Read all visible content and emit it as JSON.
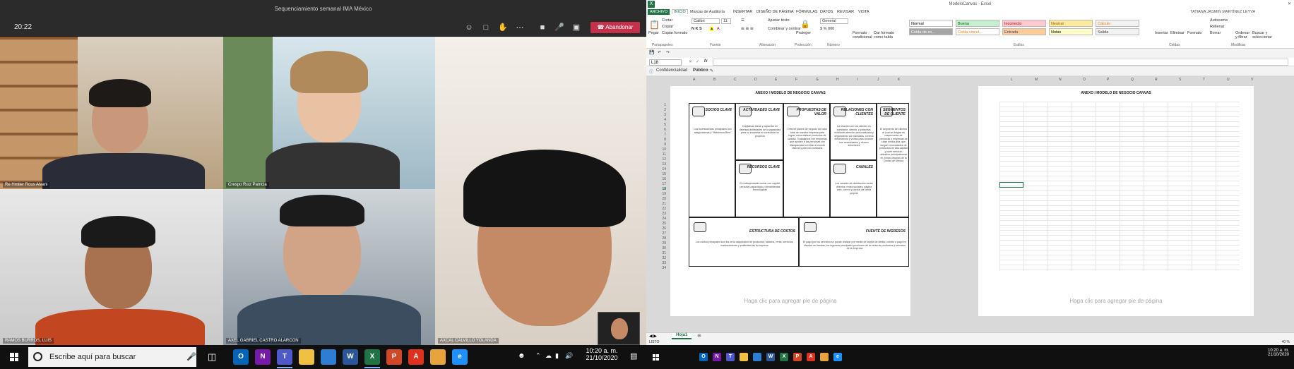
{
  "teams": {
    "window_title": "Sequenciamiento semanal IMA México",
    "time": "20:22",
    "leave_label": "Abandonar",
    "participants": [
      {
        "name": "Re Hmtier Rous Alvani"
      },
      {
        "name": "Crespo Ruiz Patricia"
      },
      {
        "name": "RAMOS BURROS, LUIS"
      },
      {
        "name": "AXEL GABRIEL CASTRO ALARCON"
      },
      {
        "name": "AXCAL CALVILLO YOLANDA"
      }
    ]
  },
  "excel": {
    "title": "ModeloCanvas - Excel",
    "user": "TATIANA JASMIN MARTÍNEZ LEYVA",
    "tabs": [
      "ARCHIVO",
      "INICIO",
      "Marcas de Auditoría",
      "INSERTAR",
      "DISEÑO DE PÁGINA",
      "FÓRMULAS",
      "DATOS",
      "REVISAR",
      "VISTA"
    ],
    "ribbon": {
      "paste": "Pegar",
      "cut": "Cortar",
      "copy": "Copiar",
      "format_painter": "Copiar formato",
      "font_name": "Calibri",
      "font_size": "11",
      "wrap_text": "Ajustar texto",
      "merge": "Combinar y centrar",
      "number_format": "General",
      "protect": "Proteger",
      "cond_format": "Formato condicional",
      "format_table": "Dar formato como tabla",
      "insert": "Insertar",
      "delete": "Eliminar",
      "format": "Formato",
      "autosum": "Autosuma",
      "fill": "Rellenar",
      "clear": "Borrar",
      "sort_filter": "Ordenar y filtrar",
      "find_select": "Buscar y seleccionar",
      "groups": [
        "Portapapeles",
        "Fuente",
        "Alineación",
        "Protección",
        "Número",
        "Estilos",
        "Celdas",
        "Modificar"
      ],
      "styles": [
        {
          "label": "Normal",
          "bg": "#ffffff",
          "fg": "#000000"
        },
        {
          "label": "Buena",
          "bg": "#c6efce",
          "fg": "#006100"
        },
        {
          "label": "Incorrecto",
          "bg": "#ffc7ce",
          "fg": "#9c0006"
        },
        {
          "label": "Neutral",
          "bg": "#ffeb9c",
          "fg": "#9c5700"
        },
        {
          "label": "Cálculo",
          "bg": "#f2f2f2",
          "fg": "#fa7d00"
        },
        {
          "label": "Celda de co...",
          "bg": "#a5a5a5",
          "fg": "#ffffff"
        },
        {
          "label": "Celda vincul...",
          "bg": "#ffffff",
          "fg": "#fa7d00"
        },
        {
          "label": "Entrada",
          "bg": "#ffcc99",
          "fg": "#3f3f76"
        },
        {
          "label": "Notas",
          "bg": "#ffffcc",
          "fg": "#000000"
        },
        {
          "label": "Salida",
          "bg": "#f2f2f2",
          "fg": "#3f3f3f"
        }
      ]
    },
    "name_box": "L18",
    "fx": "fx",
    "info_bar": {
      "label": "Confidencialidad",
      "value": "Público"
    },
    "columns_left": [
      "A",
      "B",
      "C",
      "D",
      "E",
      "F",
      "G",
      "H",
      "I",
      "J",
      "K"
    ],
    "columns_right": [
      "L",
      "M",
      "N",
      "O",
      "P",
      "Q",
      "R",
      "S",
      "T",
      "U",
      "V"
    ],
    "rows": [
      "1",
      "2",
      "3",
      "4",
      "5",
      "6",
      "7",
      "8",
      "9",
      "10",
      "11",
      "12",
      "13",
      "14",
      "15",
      "16",
      "17",
      "18",
      "19",
      "20",
      "21",
      "22",
      "23",
      "24",
      "25",
      "26",
      "27",
      "28",
      "29",
      "30",
      "31",
      "32",
      "33",
      "34"
    ],
    "page_title": "ANEXO I MODELO DE NEGOCIO CANVAS",
    "page2_title": "ANEXO I MODELO DE NEGOCIO CANVAS",
    "canvas": {
      "socios": {
        "title": "SOCIOS CLAVE",
        "text": "Los inversionistas principales son aseguradoras y \"Hablemos Bien\""
      },
      "actividades": {
        "title": "ACTIVIDADES CLAVE",
        "text": "Capitalizar ideas y capacitar en diversas actividades de la capacidad para su empresa en consolidar su proyecto"
      },
      "propuestas": {
        "title": "PROPUESTAS DE VALOR",
        "text": "Ofrecer planes de negocio de valor total de nuestra empresa para lograr comercializar productos de calidad. Trabajamos con empresas que ayuden a las personas con discapacidad a entrar al mundo laboral y para los invitados"
      },
      "relaciones": {
        "title": "RELACIONES CON CLIENTES",
        "text": "La relación con los clientes es constante, directa, y proactiva; mediante atención personalizada y seguimiento con llamadas, correos electrónicos y visitas para conocer sus necesidades y ofrecer soluciones"
      },
      "segmentos": {
        "title": "SEGMENTOS DE CLIENTE",
        "text": "El segmento de clientes al cual se dirigirá es mayormente de personas y empresas de clase media-alta, que tengan necesidades de productos de alta calidad y buen servicio; ubicados principalmente en zonas urbanas de la Ciudad de México"
      },
      "recursos": {
        "title": "RECURSOS CLAVE",
        "text": "Es indispensable contar con capital, personal capacitado y herramientas tecnológicas"
      },
      "canales": {
        "title": "CANALES",
        "text": "Los canales de distribución serán directos: redes sociales, página web, correo y puntos de venta propios"
      },
      "costos": {
        "title": "ESTRUCTURA DE COSTOS",
        "text": "Los costos principales son los de la adquisición de productos, salarios, renta, servicios, mantenimiento y publicidad de la empresa"
      },
      "ingresos": {
        "title": "FUENTE DE INGRESOS",
        "text": "El pago por los servicios se puede realizar por medio de tarjeta de débito, crédito o pago en efectivo en tiendas; los ingresos principales provienen de la venta de productos y servicios de la empresa"
      }
    },
    "footer_placeholder": "Haga clic para agregar pie de página",
    "sheet_tab": "Hoja1",
    "status_ready": "LISTO",
    "zoom": "40 %"
  },
  "taskbar": {
    "search_placeholder": "Escribe aquí para buscar",
    "time": "10:20 a. m.",
    "date": "21/10/2020",
    "time_right": "10:20 a. m.",
    "date_right": "21/10/2020",
    "apps": [
      {
        "letter": "O",
        "color": "#0364b8"
      },
      {
        "letter": "N",
        "color": "#7719aa"
      },
      {
        "letter": "T",
        "color": "#5059c9"
      },
      {
        "letter": "",
        "color": "#f0c040"
      },
      {
        "letter": "",
        "color": "#2d7dd2"
      },
      {
        "letter": "W",
        "color": "#2b579a"
      },
      {
        "letter": "X",
        "color": "#217346"
      },
      {
        "letter": "P",
        "color": "#d24726"
      },
      {
        "letter": "A",
        "color": "#e0301e"
      },
      {
        "letter": "",
        "color": "#e8a33d"
      },
      {
        "letter": "e",
        "color": "#1e90ff"
      }
    ]
  },
  "colors": {
    "excel_green": "#217346",
    "teams_leave": "#c4314b"
  }
}
